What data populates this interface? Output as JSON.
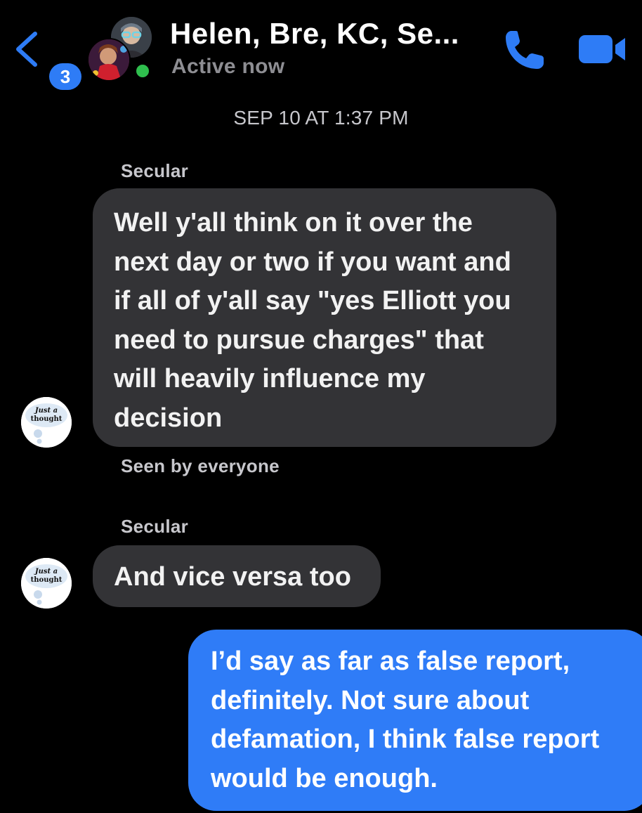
{
  "header": {
    "back_badge": "3",
    "title": "Helen, Bre, KC, Se...",
    "status": "Active now",
    "icons": {
      "back": "chevron-left-icon",
      "call": "phone-icon",
      "video": "video-camera-icon"
    },
    "accent_color": "#2e7cf6",
    "online_color": "#2fbf4e"
  },
  "thread": {
    "timestamp": "SEP 10 AT 1:37 PM",
    "messages": [
      {
        "sender": "Secular",
        "avatar_text": [
          "Just a",
          "thought"
        ],
        "lines": [
          "Well y'all think on it over the",
          "next day or two if you want and",
          "if all of y'all say \"yes Elliott you",
          "need to pursue charges\" that",
          "will heavily influence my",
          "decision"
        ],
        "receipt": "Seen by everyone"
      },
      {
        "sender": "Secular",
        "avatar_text": [
          "Just a",
          "thought"
        ],
        "lines": [
          "And vice versa too"
        ]
      },
      {
        "sender": "me",
        "lines": [
          "I’d say as far as false report,",
          "definitely. Not sure about",
          "defamation, I think false report",
          "would be enough."
        ]
      }
    ]
  },
  "colors": {
    "incoming_bubble": "#333336",
    "outgoing_bubble": "#2f7cf7",
    "background": "#000000"
  }
}
